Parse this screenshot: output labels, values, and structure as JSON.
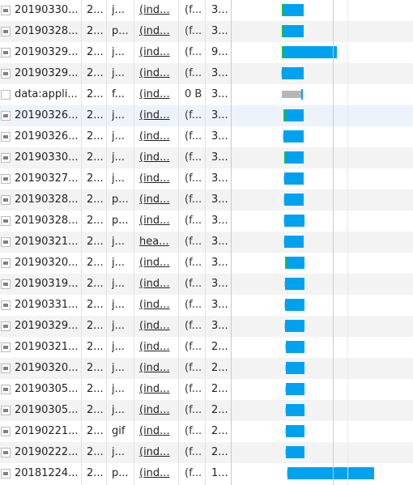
{
  "colors": {
    "bar": "#00a2ef",
    "data_uri_bar": "#b6b6b6",
    "guide_line": "#c7c7f5"
  },
  "rows": [
    {
      "name": "20190330...",
      "status": "2...",
      "type": "j...",
      "initiator": "(ind...",
      "size": "(f...",
      "time": "3...",
      "thumb": "image",
      "bar": {
        "start": 348,
        "width": 27
      },
      "green": true
    },
    {
      "name": "20190328...",
      "status": "2...",
      "type": "p...",
      "initiator": "(ind...",
      "size": "(f...",
      "time": "3...",
      "thumb": "image",
      "bar": {
        "start": 348,
        "width": 27
      },
      "green": true
    },
    {
      "name": "20190329...",
      "status": "2...",
      "type": "j...",
      "initiator": "(ind...",
      "size": "(f...",
      "time": "9...",
      "thumb": "image",
      "bar": {
        "start": 348,
        "width": 68
      },
      "green": true
    },
    {
      "name": "20190329...",
      "status": "2...",
      "type": "j...",
      "initiator": "(ind...",
      "size": "(f...",
      "time": "3...",
      "thumb": "image",
      "bar": {
        "start": 348,
        "width": 27
      },
      "green": false
    },
    {
      "name": "data:appli...",
      "status": "2...",
      "type": "f...",
      "initiator": "(ind...",
      "size": "0 B",
      "time": "3...",
      "thumb": "blank",
      "bar": {
        "start": 348,
        "width": 24,
        "gray": true
      },
      "green": false
    },
    {
      "name": "20190326...",
      "status": "2...",
      "type": "j...",
      "initiator": "(ind...",
      "size": "(f...",
      "time": "3...",
      "thumb": "image",
      "bar": {
        "start": 350,
        "width": 25
      },
      "green": true
    },
    {
      "name": "20190326...",
      "status": "2...",
      "type": "j...",
      "initiator": "(ind...",
      "size": "(f...",
      "time": "3...",
      "thumb": "image",
      "bar": {
        "start": 350,
        "width": 25
      },
      "green": false
    },
    {
      "name": "20190330...",
      "status": "2...",
      "type": "j...",
      "initiator": "(ind...",
      "size": "(f...",
      "time": "3...",
      "thumb": "image",
      "bar": {
        "start": 351,
        "width": 24
      },
      "green": true
    },
    {
      "name": "20190327...",
      "status": "2...",
      "type": "j...",
      "initiator": "(ind...",
      "size": "(f...",
      "time": "3...",
      "thumb": "image",
      "bar": {
        "start": 351,
        "width": 24
      },
      "green": false
    },
    {
      "name": "20190328...",
      "status": "2...",
      "type": "p...",
      "initiator": "(ind...",
      "size": "(f...",
      "time": "3...",
      "thumb": "image",
      "bar": {
        "start": 351,
        "width": 24
      },
      "green": false
    },
    {
      "name": "20190328...",
      "status": "2...",
      "type": "p...",
      "initiator": "(ind...",
      "size": "(f...",
      "time": "3...",
      "thumb": "image",
      "bar": {
        "start": 351,
        "width": 25
      },
      "green": false
    },
    {
      "name": "20190321...",
      "status": "2...",
      "type": "j...",
      "initiator": "hea...",
      "size": "(f...",
      "time": "3...",
      "thumb": "image",
      "bar": {
        "start": 351,
        "width": 24
      },
      "green": false
    },
    {
      "name": "20190320...",
      "status": "2...",
      "type": "j...",
      "initiator": "(ind...",
      "size": "(f...",
      "time": "3...",
      "thumb": "image",
      "bar": {
        "start": 352,
        "width": 24
      },
      "green": true
    },
    {
      "name": "20190319...",
      "status": "2...",
      "type": "j...",
      "initiator": "(ind...",
      "size": "(f...",
      "time": "3...",
      "thumb": "image",
      "bar": {
        "start": 352,
        "width": 24
      },
      "green": false
    },
    {
      "name": "20190331...",
      "status": "2...",
      "type": "j...",
      "initiator": "(ind...",
      "size": "(f...",
      "time": "3...",
      "thumb": "image",
      "bar": {
        "start": 352,
        "width": 24
      },
      "green": false
    },
    {
      "name": "20190329...",
      "status": "2...",
      "type": "j...",
      "initiator": "(ind...",
      "size": "(f...",
      "time": "3...",
      "thumb": "image",
      "bar": {
        "start": 352,
        "width": 24
      },
      "green": false
    },
    {
      "name": "20190321...",
      "status": "2...",
      "type": "j...",
      "initiator": "(ind...",
      "size": "(f...",
      "time": "2...",
      "thumb": "image",
      "bar": {
        "start": 353,
        "width": 23
      },
      "green": false
    },
    {
      "name": "20190320...",
      "status": "2...",
      "type": "j...",
      "initiator": "(ind...",
      "size": "(f...",
      "time": "2...",
      "thumb": "image",
      "bar": {
        "start": 353,
        "width": 23
      },
      "green": false
    },
    {
      "name": "20190305...",
      "status": "2...",
      "type": "j...",
      "initiator": "(ind...",
      "size": "(f...",
      "time": "2...",
      "thumb": "image",
      "bar": {
        "start": 353,
        "width": 23
      },
      "green": false
    },
    {
      "name": "20190305...",
      "status": "2...",
      "type": "j...",
      "initiator": "(ind...",
      "size": "(f...",
      "time": "2...",
      "thumb": "image",
      "bar": {
        "start": 353,
        "width": 23
      },
      "green": false
    },
    {
      "name": "20190221...",
      "status": "2...",
      "type": "gif",
      "initiator": "(ind...",
      "size": "(f...",
      "time": "2...",
      "thumb": "image",
      "bar": {
        "start": 353,
        "width": 23
      },
      "green": false
    },
    {
      "name": "20190222...",
      "status": "2...",
      "type": "j...",
      "initiator": "(ind...",
      "size": "(f...",
      "time": "2...",
      "thumb": "image",
      "bar": {
        "start": 353,
        "width": 23
      },
      "green": false
    },
    {
      "name": "20181224...",
      "status": "2...",
      "type": "p...",
      "initiator": "(ind...",
      "size": "(f...",
      "time": "1...",
      "thumb": "image",
      "bar": {
        "start": 355,
        "width": 107
      },
      "green": false
    }
  ]
}
